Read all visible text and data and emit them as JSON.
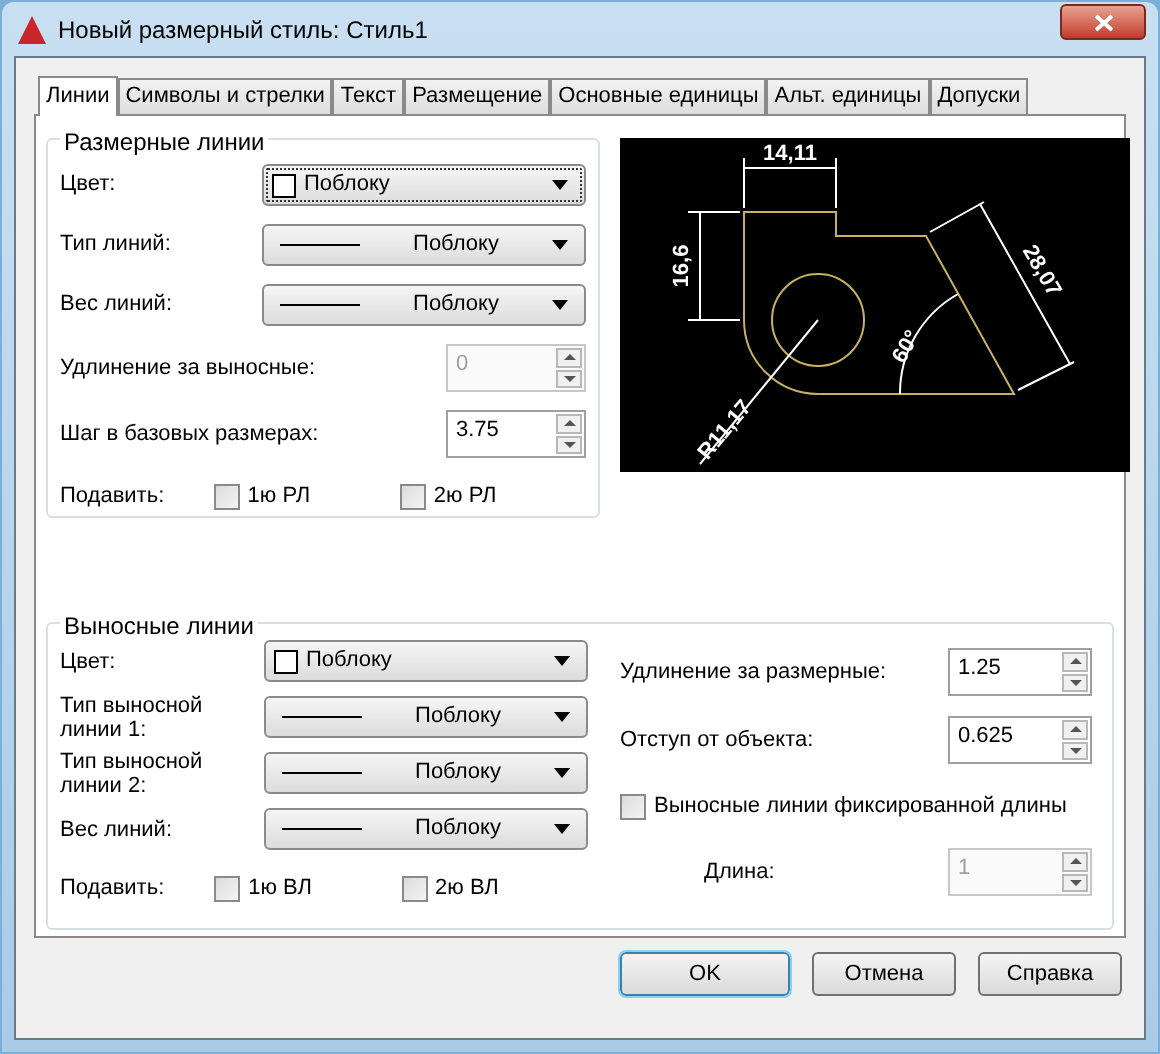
{
  "window": {
    "title": "Новый размерный стиль: Стиль1"
  },
  "tabs": [
    {
      "label": "Линии",
      "selected": true
    },
    {
      "label": "Символы и стрелки",
      "selected": false
    },
    {
      "label": "Текст",
      "selected": false
    },
    {
      "label": "Размещение",
      "selected": false
    },
    {
      "label": "Основные единицы",
      "selected": false
    },
    {
      "label": "Альт. единицы",
      "selected": false
    },
    {
      "label": "Допуски",
      "selected": false
    }
  ],
  "dimension_lines": {
    "title": "Размерные линии",
    "rows": [
      {
        "kind": "color",
        "label": "Цвет:",
        "value": "Поблоку",
        "focused": true
      },
      {
        "kind": "linetype",
        "label": "Тип линий:",
        "value": "Поблоку",
        "focused": false
      },
      {
        "kind": "linetype",
        "label": "Вес линий:",
        "value": "Поблоку",
        "focused": false
      },
      {
        "kind": "spinner",
        "label": "Удлинение за выносные:",
        "value": "0",
        "disabled": true
      },
      {
        "kind": "spinner",
        "label": "Шаг в базовых размерах:",
        "value": "3.75",
        "disabled": false
      }
    ],
    "suppress": {
      "label": "Подавить:",
      "options": [
        {
          "label": "1ю РЛ",
          "checked": false
        },
        {
          "label": "2ю РЛ",
          "checked": false
        }
      ]
    }
  },
  "preview": {
    "labels": [
      "14,11",
      "16,6",
      "28,07",
      "60°",
      "R11,17"
    ]
  },
  "extension_lines": {
    "title": "Выносные линии",
    "rows": [
      {
        "kind": "color",
        "label": "Цвет:",
        "value": "Поблоку",
        "focused": false
      },
      {
        "kind": "linetype",
        "label": "Тип выносной линии 1:",
        "value": "Поблоку",
        "focused": false
      },
      {
        "kind": "linetype",
        "label": "Тип выносной линии 2:",
        "value": "Поблоку",
        "focused": false
      },
      {
        "kind": "linetype",
        "label": "Вес линий:",
        "value": "Поблоку",
        "focused": false
      }
    ],
    "suppress": {
      "label": "Подавить:",
      "options": [
        {
          "label": "1ю ВЛ",
          "checked": false
        },
        {
          "label": "2ю ВЛ",
          "checked": false
        }
      ]
    },
    "right_rows": [
      {
        "kind": "spinner",
        "label": "Удлинение за размерные:",
        "value": "1.25",
        "disabled": false
      },
      {
        "kind": "spinner",
        "label": "Отступ от объекта:",
        "value": "0.625",
        "disabled": false
      },
      {
        "kind": "checkbox",
        "label": "Выносные линии фиксированной длины",
        "checked": false
      },
      {
        "kind": "indented_spinner",
        "label": "Длина:",
        "value": "1",
        "disabled": true
      }
    ]
  },
  "buttons": [
    {
      "label": "OK",
      "default": true
    },
    {
      "label": "Отмена",
      "default": false
    },
    {
      "label": "Справка",
      "default": false
    }
  ]
}
